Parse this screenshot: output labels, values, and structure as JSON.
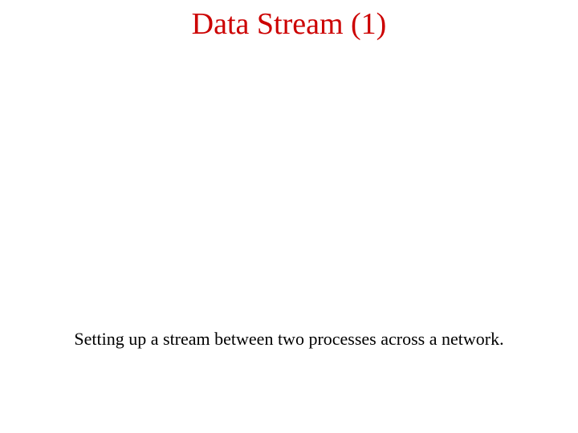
{
  "slide": {
    "title": "Data Stream (1)",
    "caption": "Setting up a stream between two processes across a network."
  }
}
